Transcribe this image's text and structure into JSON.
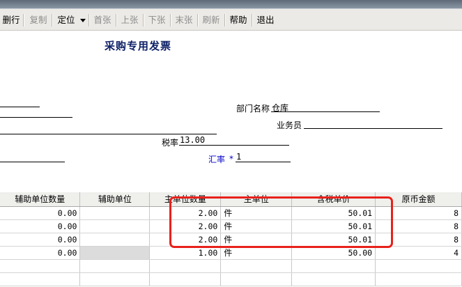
{
  "toolbar": {
    "buttons": [
      {
        "label": "删行",
        "enabled": true
      },
      {
        "label": "复制",
        "enabled": false
      },
      {
        "label": "定位",
        "enabled": true
      },
      {
        "label": "首张",
        "enabled": false
      },
      {
        "label": "上张",
        "enabled": false
      },
      {
        "label": "下张",
        "enabled": false
      },
      {
        "label": "末张",
        "enabled": false
      },
      {
        "label": "刷新",
        "enabled": false
      },
      {
        "label": "帮助",
        "enabled": true
      },
      {
        "label": "退出",
        "enabled": true
      }
    ]
  },
  "form": {
    "title": "采购专用发票",
    "dept_label": "部门名称",
    "dept_value": "仓库",
    "salesman_label": "业务员",
    "salesman_value": "",
    "tax_label": "税率",
    "tax_value": "13.00",
    "exchange_label": "汇率",
    "exchange_required": "*",
    "exchange_value": "1"
  },
  "grid": {
    "columns": [
      "辅助单位数量",
      "辅助单位",
      "主单位数量",
      "主单位",
      "含税单价",
      "原币金额"
    ],
    "rows": [
      {
        "aux_qty": "0.00",
        "aux_unit": "",
        "main_qty": "2.00",
        "main_unit": "件",
        "unit_price": "50.01",
        "amount": "8"
      },
      {
        "aux_qty": "0.00",
        "aux_unit": "",
        "main_qty": "2.00",
        "main_unit": "件",
        "unit_price": "50.01",
        "amount": "8"
      },
      {
        "aux_qty": "0.00",
        "aux_unit": "",
        "main_qty": "2.00",
        "main_unit": "件",
        "unit_price": "50.01",
        "amount": "8"
      },
      {
        "aux_qty": "0.00",
        "aux_unit": "",
        "main_qty": "1.00",
        "main_unit": "件",
        "unit_price": "50.00",
        "amount": "4"
      }
    ]
  },
  "colors": {
    "title": "#0c1f66",
    "highlight": "#e8211b",
    "required_label": "#0000c8"
  }
}
